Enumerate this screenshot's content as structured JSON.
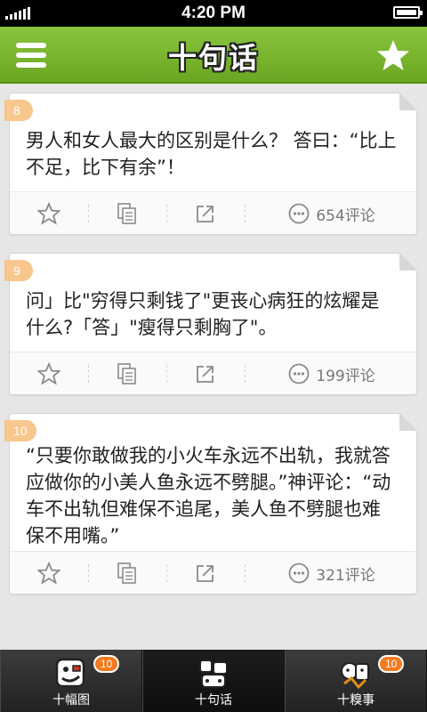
{
  "status_bar": {
    "time": "4:20 PM"
  },
  "header": {
    "title": "十句话"
  },
  "cards": [
    {
      "number": "8",
      "text": "男人和女人最大的区别是什么？ 答曰：“比上不足，比下有余”！",
      "comments": "654评论"
    },
    {
      "number": "9",
      "text": "问」比\"穷得只剩钱了\"更丧心病狂的炫耀是什么?「答」\"瘦得只剩胸了\"。",
      "comments": "199评论"
    },
    {
      "number": "10",
      "text": "“只要你敢做我的小火车永远不出轨，我就答应做你的小美人鱼永远不劈腿。”神评论：“动车不出轨但难保不追尾，美人鱼不劈腿也难保不用嘴。”",
      "comments": "321评论"
    }
  ],
  "tabbar": {
    "tabs": [
      {
        "label": "十幅图",
        "badge": "10"
      },
      {
        "label": "十句话",
        "badge": ""
      },
      {
        "label": "十糗事",
        "badge": "10"
      }
    ]
  }
}
